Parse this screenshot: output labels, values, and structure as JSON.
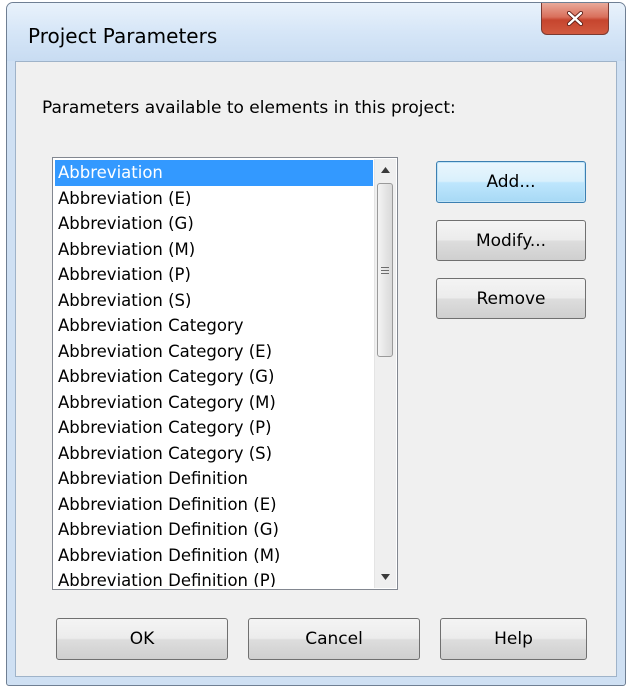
{
  "window": {
    "title": "Project Parameters"
  },
  "dialog": {
    "prompt": "Parameters available to elements in this project:"
  },
  "parameters": {
    "selected_index": 0,
    "items": [
      "Abbreviation",
      "Abbreviation (E)",
      "Abbreviation (G)",
      "Abbreviation (M)",
      "Abbreviation (P)",
      "Abbreviation (S)",
      "Abbreviation Category",
      "Abbreviation Category (E)",
      "Abbreviation Category (G)",
      "Abbreviation Category (M)",
      "Abbreviation Category (P)",
      "Abbreviation Category (S)",
      "Abbreviation Definition",
      "Abbreviation Definition (E)",
      "Abbreviation Definition (G)",
      "Abbreviation Definition (M)",
      "Abbreviation Definition (P)"
    ]
  },
  "side_buttons": {
    "add": "Add...",
    "modify": "Modify...",
    "remove": "Remove"
  },
  "footer_buttons": {
    "ok": "OK",
    "cancel": "Cancel",
    "help": "Help"
  },
  "colors": {
    "selection": "#3399ff",
    "close_button": "#c6452e",
    "default_button": "#bee6fd"
  },
  "icons": {
    "close": "close-x-icon",
    "scroll_up": "triangle-up-icon",
    "scroll_down": "triangle-down-icon",
    "scroll_grip": "grip-lines-icon"
  }
}
